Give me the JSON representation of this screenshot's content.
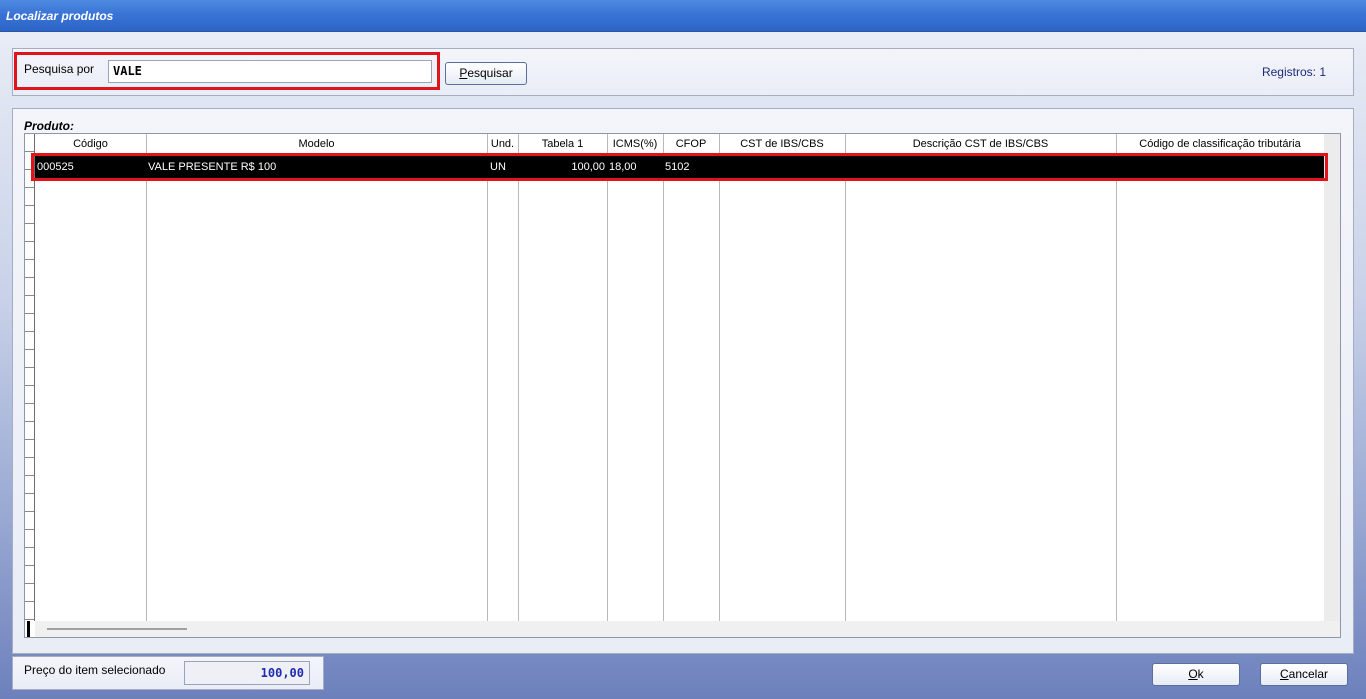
{
  "window": {
    "title": "Localizar produtos"
  },
  "search": {
    "label": "Pesquisa por",
    "value": "VALE",
    "button_label": "Pesquisar",
    "button_mnemonic": "P",
    "button_rest": "esquisar",
    "records_text": "Registros: 1"
  },
  "grid": {
    "caption": "Produto:",
    "columns": [
      "Código",
      "Modelo",
      "Und.",
      "Tabela 1",
      "ICMS(%)",
      "CFOP",
      "CST de IBS/CBS",
      "Descrição CST de IBS/CBS",
      "Código de classificação tributária"
    ],
    "rows": [
      {
        "codigo": "000525",
        "modelo": "VALE PRESENTE R$ 100",
        "und": "UN",
        "tabela1": "100,00",
        "icms": "18,00",
        "cfop": "5102",
        "cst": "",
        "descricao_cst": "",
        "classificacao": ""
      }
    ]
  },
  "footer": {
    "price_label": "Preço do item selecionado",
    "price_value": "100,00",
    "ok_label": "Ok",
    "ok_mnemonic": "O",
    "ok_rest": "k",
    "cancel_label": "Cancelar",
    "cancel_mnemonic": "C",
    "cancel_rest": "ancelar"
  },
  "colors": {
    "title_bar": "#3a74d6",
    "highlight": "#e0141b",
    "selected_row": "#000000",
    "price_text": "#1f2bb0"
  }
}
